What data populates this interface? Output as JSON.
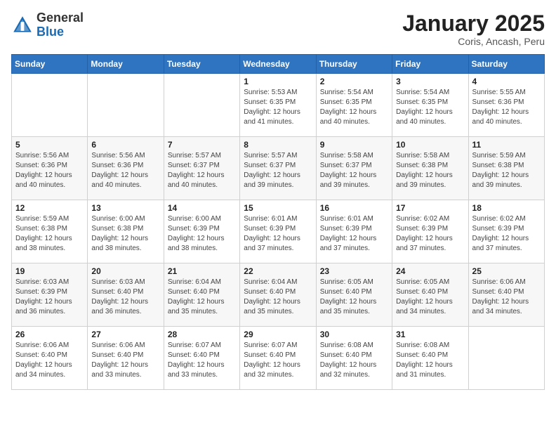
{
  "logo": {
    "general": "General",
    "blue": "Blue"
  },
  "title": "January 2025",
  "subtitle": "Coris, Ancash, Peru",
  "weekdays": [
    "Sunday",
    "Monday",
    "Tuesday",
    "Wednesday",
    "Thursday",
    "Friday",
    "Saturday"
  ],
  "weeks": [
    [
      {
        "day": "",
        "info": ""
      },
      {
        "day": "",
        "info": ""
      },
      {
        "day": "",
        "info": ""
      },
      {
        "day": "1",
        "info": "Sunrise: 5:53 AM\nSunset: 6:35 PM\nDaylight: 12 hours\nand 41 minutes."
      },
      {
        "day": "2",
        "info": "Sunrise: 5:54 AM\nSunset: 6:35 PM\nDaylight: 12 hours\nand 40 minutes."
      },
      {
        "day": "3",
        "info": "Sunrise: 5:54 AM\nSunset: 6:35 PM\nDaylight: 12 hours\nand 40 minutes."
      },
      {
        "day": "4",
        "info": "Sunrise: 5:55 AM\nSunset: 6:36 PM\nDaylight: 12 hours\nand 40 minutes."
      }
    ],
    [
      {
        "day": "5",
        "info": "Sunrise: 5:56 AM\nSunset: 6:36 PM\nDaylight: 12 hours\nand 40 minutes."
      },
      {
        "day": "6",
        "info": "Sunrise: 5:56 AM\nSunset: 6:36 PM\nDaylight: 12 hours\nand 40 minutes."
      },
      {
        "day": "7",
        "info": "Sunrise: 5:57 AM\nSunset: 6:37 PM\nDaylight: 12 hours\nand 40 minutes."
      },
      {
        "day": "8",
        "info": "Sunrise: 5:57 AM\nSunset: 6:37 PM\nDaylight: 12 hours\nand 39 minutes."
      },
      {
        "day": "9",
        "info": "Sunrise: 5:58 AM\nSunset: 6:37 PM\nDaylight: 12 hours\nand 39 minutes."
      },
      {
        "day": "10",
        "info": "Sunrise: 5:58 AM\nSunset: 6:38 PM\nDaylight: 12 hours\nand 39 minutes."
      },
      {
        "day": "11",
        "info": "Sunrise: 5:59 AM\nSunset: 6:38 PM\nDaylight: 12 hours\nand 39 minutes."
      }
    ],
    [
      {
        "day": "12",
        "info": "Sunrise: 5:59 AM\nSunset: 6:38 PM\nDaylight: 12 hours\nand 38 minutes."
      },
      {
        "day": "13",
        "info": "Sunrise: 6:00 AM\nSunset: 6:38 PM\nDaylight: 12 hours\nand 38 minutes."
      },
      {
        "day": "14",
        "info": "Sunrise: 6:00 AM\nSunset: 6:39 PM\nDaylight: 12 hours\nand 38 minutes."
      },
      {
        "day": "15",
        "info": "Sunrise: 6:01 AM\nSunset: 6:39 PM\nDaylight: 12 hours\nand 37 minutes."
      },
      {
        "day": "16",
        "info": "Sunrise: 6:01 AM\nSunset: 6:39 PM\nDaylight: 12 hours\nand 37 minutes."
      },
      {
        "day": "17",
        "info": "Sunrise: 6:02 AM\nSunset: 6:39 PM\nDaylight: 12 hours\nand 37 minutes."
      },
      {
        "day": "18",
        "info": "Sunrise: 6:02 AM\nSunset: 6:39 PM\nDaylight: 12 hours\nand 37 minutes."
      }
    ],
    [
      {
        "day": "19",
        "info": "Sunrise: 6:03 AM\nSunset: 6:39 PM\nDaylight: 12 hours\nand 36 minutes."
      },
      {
        "day": "20",
        "info": "Sunrise: 6:03 AM\nSunset: 6:40 PM\nDaylight: 12 hours\nand 36 minutes."
      },
      {
        "day": "21",
        "info": "Sunrise: 6:04 AM\nSunset: 6:40 PM\nDaylight: 12 hours\nand 35 minutes."
      },
      {
        "day": "22",
        "info": "Sunrise: 6:04 AM\nSunset: 6:40 PM\nDaylight: 12 hours\nand 35 minutes."
      },
      {
        "day": "23",
        "info": "Sunrise: 6:05 AM\nSunset: 6:40 PM\nDaylight: 12 hours\nand 35 minutes."
      },
      {
        "day": "24",
        "info": "Sunrise: 6:05 AM\nSunset: 6:40 PM\nDaylight: 12 hours\nand 34 minutes."
      },
      {
        "day": "25",
        "info": "Sunrise: 6:06 AM\nSunset: 6:40 PM\nDaylight: 12 hours\nand 34 minutes."
      }
    ],
    [
      {
        "day": "26",
        "info": "Sunrise: 6:06 AM\nSunset: 6:40 PM\nDaylight: 12 hours\nand 34 minutes."
      },
      {
        "day": "27",
        "info": "Sunrise: 6:06 AM\nSunset: 6:40 PM\nDaylight: 12 hours\nand 33 minutes."
      },
      {
        "day": "28",
        "info": "Sunrise: 6:07 AM\nSunset: 6:40 PM\nDaylight: 12 hours\nand 33 minutes."
      },
      {
        "day": "29",
        "info": "Sunrise: 6:07 AM\nSunset: 6:40 PM\nDaylight: 12 hours\nand 32 minutes."
      },
      {
        "day": "30",
        "info": "Sunrise: 6:08 AM\nSunset: 6:40 PM\nDaylight: 12 hours\nand 32 minutes."
      },
      {
        "day": "31",
        "info": "Sunrise: 6:08 AM\nSunset: 6:40 PM\nDaylight: 12 hours\nand 31 minutes."
      },
      {
        "day": "",
        "info": ""
      }
    ]
  ]
}
